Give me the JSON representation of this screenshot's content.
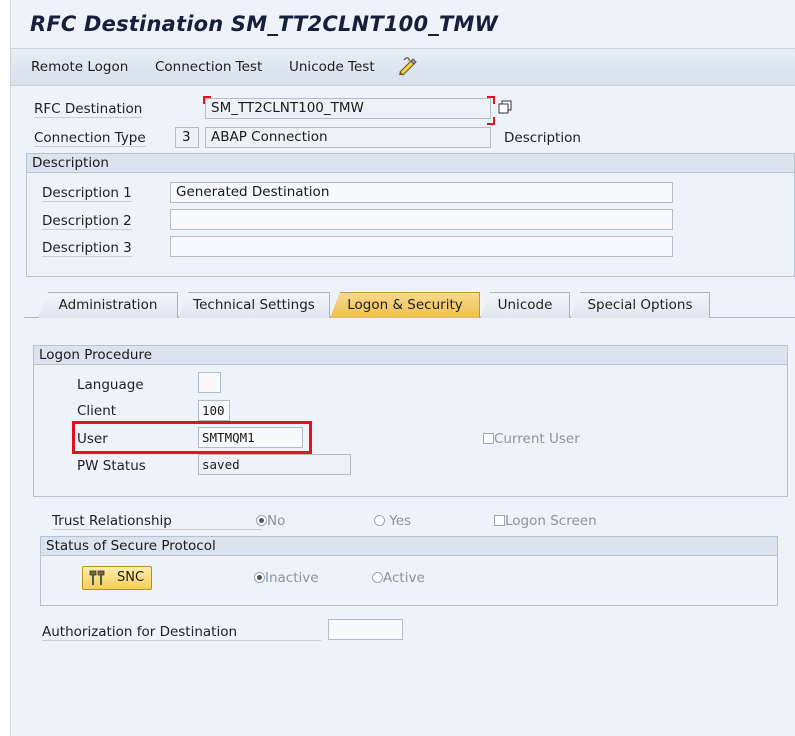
{
  "window": {
    "title": "RFC Destination SM_TT2CLNT100_TMW"
  },
  "toolbar": {
    "remote_logon": "Remote Logon",
    "connection_test": "Connection Test",
    "unicode_test": "Unicode Test",
    "tool_icon": "pencil-tool-icon"
  },
  "header": {
    "rfc_destination_label": "RFC Destination",
    "rfc_destination_value": "SM_TT2CLNT100_TMW",
    "connection_type_label": "Connection Type",
    "connection_type_code": "3",
    "connection_type_value": "ABAP Connection",
    "description_label": "Description"
  },
  "description": {
    "heading": "Description",
    "rows": [
      {
        "label": "Description 1",
        "value": "Generated Destination"
      },
      {
        "label": "Description 2",
        "value": ""
      },
      {
        "label": "Description 3",
        "value": ""
      }
    ]
  },
  "tabs": [
    {
      "label": "Administration"
    },
    {
      "label": "Technical Settings"
    },
    {
      "label": "Logon & Security",
      "active": true
    },
    {
      "label": "Unicode"
    },
    {
      "label": "Special Options"
    }
  ],
  "logon": {
    "heading": "Logon Procedure",
    "language_label": "Language",
    "language_value": "",
    "client_label": "Client",
    "client_value": "100",
    "user_label": "User",
    "user_value": "SMTMQM1",
    "current_user_label": "Current User",
    "pw_label": "PW Status",
    "pw_value": "saved",
    "highlight_color": "#e0141e"
  },
  "trust": {
    "label": "Trust Relationship",
    "no": "No",
    "yes": "Yes",
    "logon_screen": "Logon Screen",
    "selected": "No"
  },
  "secure": {
    "heading": "Status of Secure Protocol",
    "snc_label": "SNC",
    "snc_icon": "snc-tool-icon",
    "inactive": "Inactive",
    "active": "Active",
    "selected": "Inactive"
  },
  "authorization": {
    "label": "Authorization for Destination",
    "value": ""
  },
  "colors": {
    "active_tab": "#efbf52",
    "panel_bg": "#eef3f9"
  }
}
